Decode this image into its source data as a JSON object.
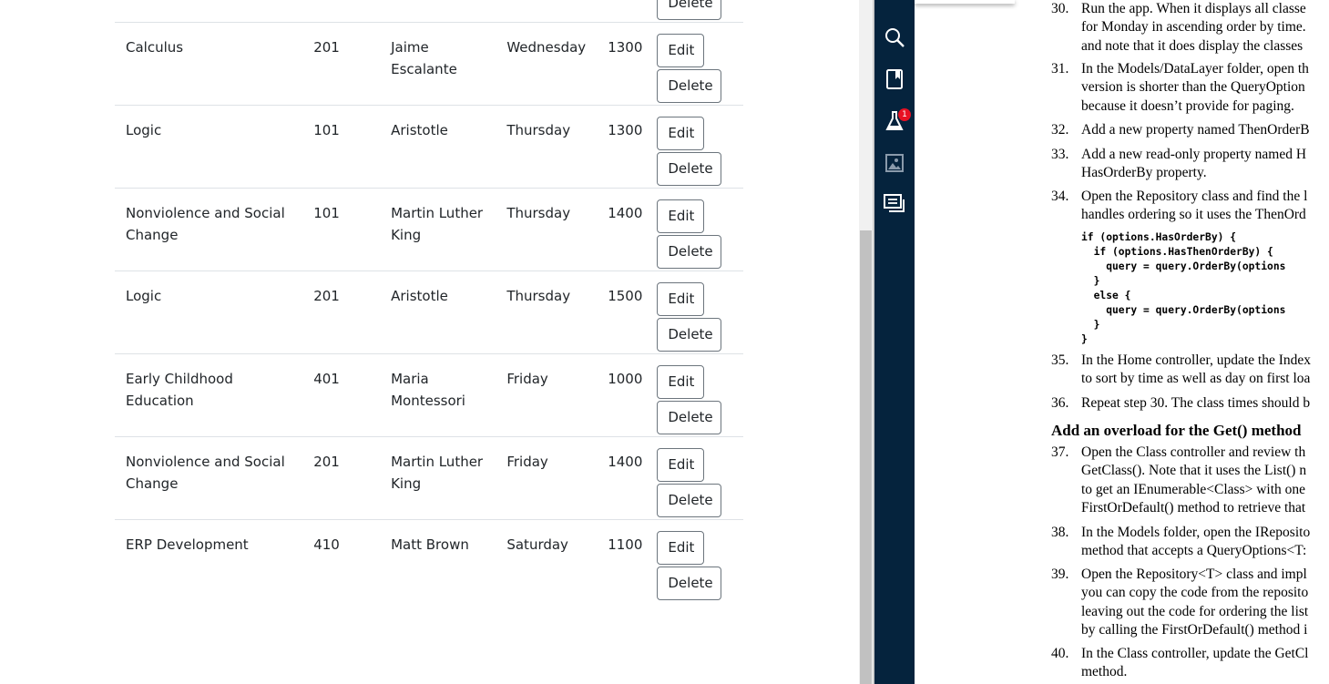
{
  "table": {
    "edit_label": "Edit",
    "delete_label": "Delete",
    "rows": [
      {
        "name": "",
        "number": "",
        "teacher": "",
        "day": "",
        "time": ""
      },
      {
        "name": "Calculus",
        "number": "201",
        "teacher": "Jaime Escalante",
        "day": "Wednesday",
        "time": "1300"
      },
      {
        "name": "Logic",
        "number": "101",
        "teacher": "Aristotle",
        "day": "Thursday",
        "time": "1300"
      },
      {
        "name": "Nonviolence and Social Change",
        "number": "101",
        "teacher": "Martin Luther King",
        "day": "Thursday",
        "time": "1400"
      },
      {
        "name": "Logic",
        "number": "201",
        "teacher": "Aristotle",
        "day": "Thursday",
        "time": "1500"
      },
      {
        "name": "Early Childhood Education",
        "number": "401",
        "teacher": "Maria Montessori",
        "day": "Friday",
        "time": "1000"
      },
      {
        "name": "Nonviolence and Social Change",
        "number": "201",
        "teacher": "Martin Luther King",
        "day": "Friday",
        "time": "1400"
      },
      {
        "name": "ERP Development",
        "number": "410",
        "teacher": "Matt Brown",
        "day": "Saturday",
        "time": "1100"
      }
    ]
  },
  "rail": {
    "icons": [
      "list-icon",
      "search-icon",
      "bookmark-icon",
      "flask-icon",
      "image-icon",
      "comments-icon"
    ],
    "badge": "1",
    "color": "#05233d"
  },
  "doc": {
    "steps": [
      {
        "num": "30.",
        "lines": [
          "Run the app. When it displays all classe",
          "for Monday in ascending order by time.",
          "and note that it does display the classes"
        ]
      },
      {
        "num": "31.",
        "lines": [
          "In the Models/DataLayer folder, open th",
          "version is shorter than the QueryOption",
          "because it doesn’t provide for paging."
        ]
      },
      {
        "num": "32.",
        "lines": [
          "Add a new property named ThenOrderB"
        ]
      },
      {
        "num": "33.",
        "lines": [
          "Add a new read-only property named H",
          "HasOrderBy property."
        ]
      },
      {
        "num": "34.",
        "lines": [
          "Open the Repository class and find the l",
          "handles ordering so it uses the ThenOrd"
        ]
      },
      {
        "num": "35.",
        "lines": [
          "In the Home controller, update the Index",
          "to sort by time as well as day on first loa"
        ]
      },
      {
        "num": "36.",
        "lines": [
          "Repeat step 30. The class times should b"
        ]
      },
      {
        "num": "37.",
        "lines": [
          "Open the Class controller and review th",
          "GetClass(). Note that it uses the List() n",
          "to get an IEnumerable<Class> with one",
          "FirstOrDefault() method to retrieve that"
        ]
      },
      {
        "num": "38.",
        "lines": [
          "In the Models folder, open the IReposito",
          "method that accepts a QueryOptions<T:"
        ]
      },
      {
        "num": "39.",
        "lines": [
          "Open the Repository<T> class and impl",
          "you can copy the code from the reposito",
          "leaving out the code for ordering the list",
          "by calling the FirstOrDefault() method i"
        ]
      },
      {
        "num": "40.",
        "lines": [
          "In the Class controller, update the GetCl",
          "method."
        ]
      }
    ],
    "code": "if (options.HasOrderBy) {\n  if (options.HasThenOrderBy) {\n    query = query.OrderBy(options\n  }\n  else {\n    query = query.OrderBy(options\n  }\n}",
    "heading": "Add an overload for the Get() method"
  }
}
